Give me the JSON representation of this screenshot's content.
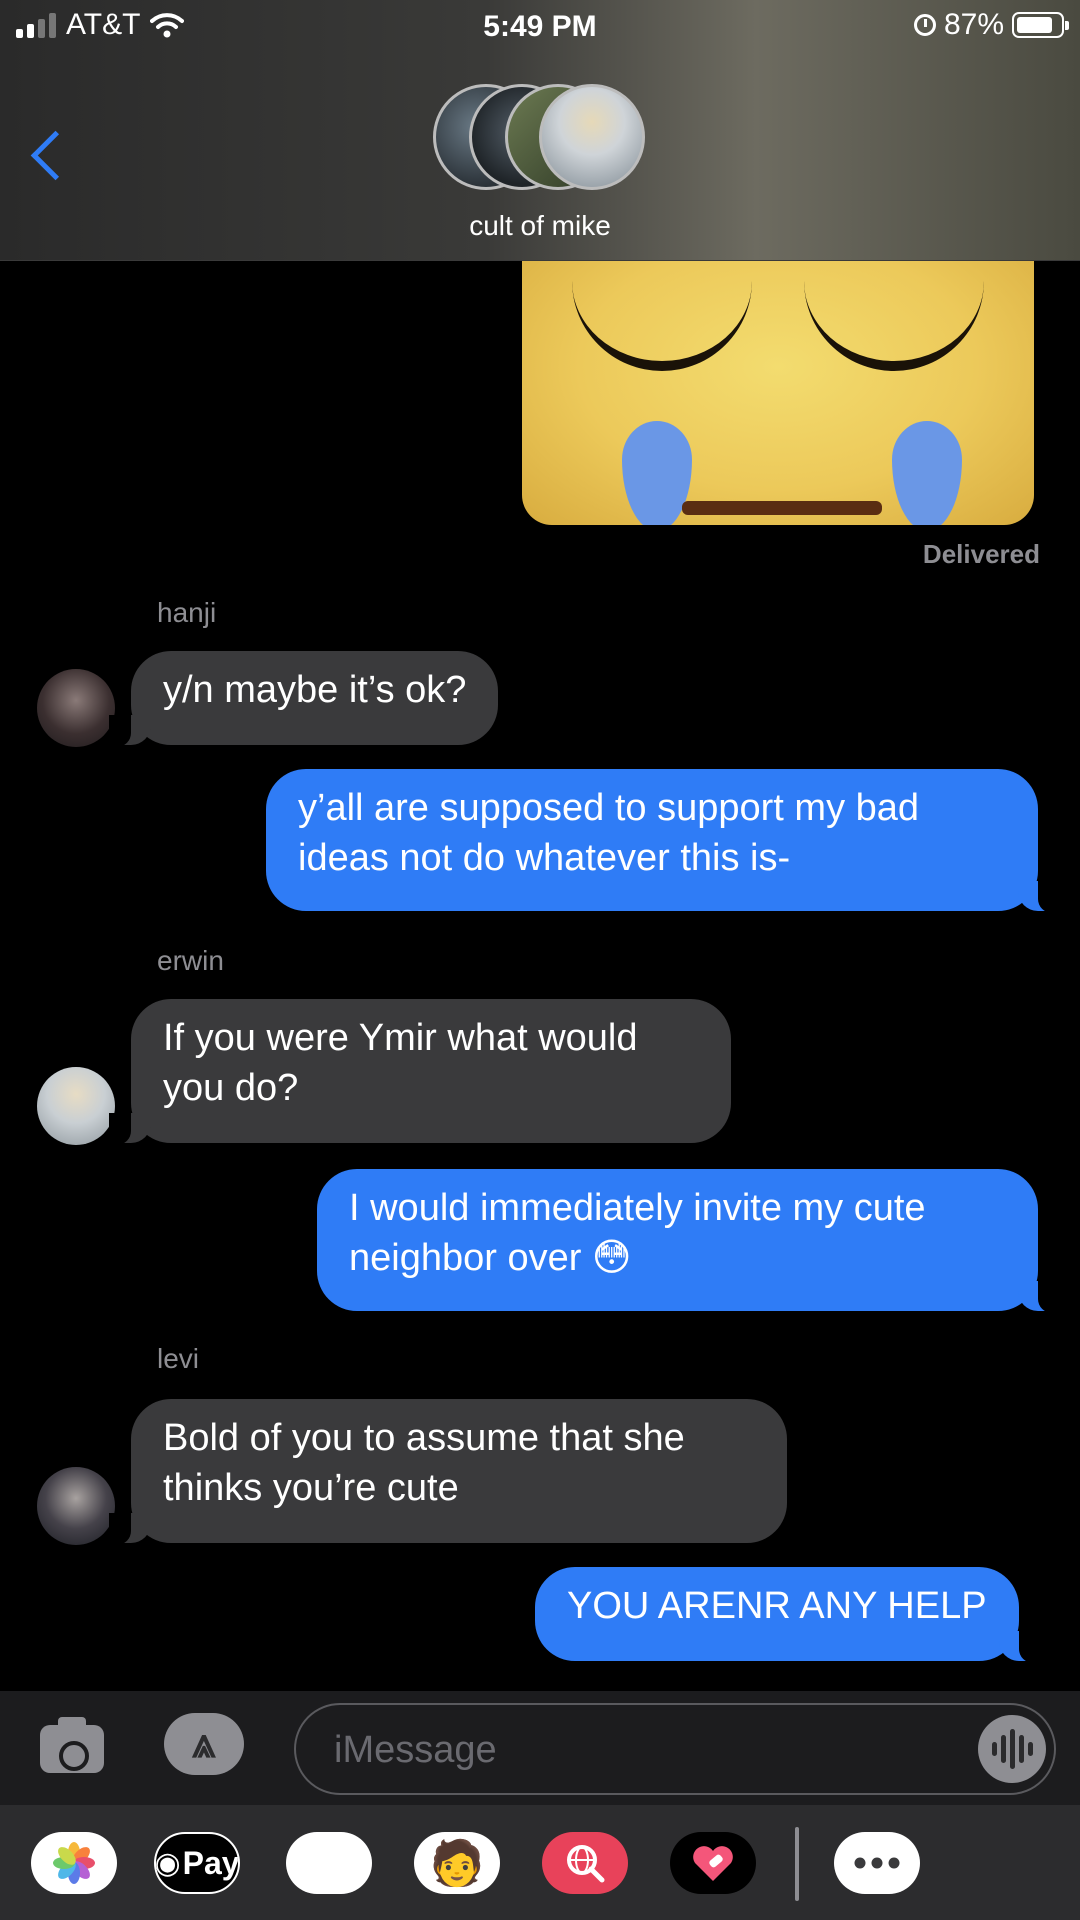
{
  "status_bar": {
    "carrier": "AT&T",
    "time": "5:49 PM",
    "battery": "87%",
    "battery_level": 0.87
  },
  "header": {
    "group_name": "cult of mike"
  },
  "thread": {
    "image_status": "Delivered",
    "messages": [
      {
        "sender": "hanji",
        "text": "y/n maybe it’s ok?"
      },
      {
        "sender": "me",
        "text": "y’all are supposed to support my bad ideas not do whatever this is-"
      },
      {
        "sender": "erwin",
        "text": "If you were Ymir what would you do?"
      },
      {
        "sender": "me",
        "text": "I would immediately invite my cute neighbor over 😳"
      },
      {
        "sender": "levi",
        "text": "Bold of you to assume that she thinks you’re cute"
      },
      {
        "sender": "me",
        "text": "YOU ARENR ANY HELP"
      }
    ]
  },
  "input": {
    "placeholder": "iMessage"
  },
  "drawer": {
    "pay_label": "Pay"
  },
  "colors": {
    "accent": "#2f7cf6",
    "incoming_bubble": "#3a3a3c"
  },
  "icons": [
    "back-chevron-icon",
    "wifi-icon",
    "alarm-icon",
    "battery-icon",
    "camera-icon",
    "app-store-icon",
    "audio-waveform-icon",
    "photos-icon",
    "apple-pay-icon",
    "animoji-icon",
    "memoji-icon",
    "image-search-icon",
    "digital-touch-icon",
    "more-icon"
  ]
}
